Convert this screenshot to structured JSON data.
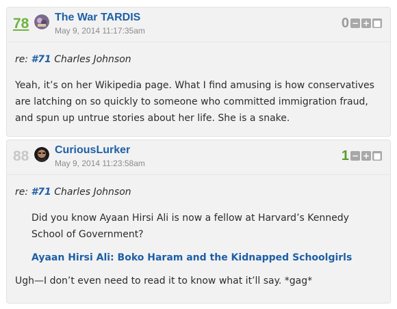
{
  "comments": [
    {
      "number": "78",
      "username": "The War TARDIS",
      "timestamp": "May 9, 2014 11:17:35am",
      "score": "0",
      "reply_prefix": "re:",
      "reply_link": "#71",
      "reply_name": "Charles Johnson",
      "body": "Yeah, it’s on her Wikipedia page. What I find amusing is how conservatives are latching on so quickly to someone who committed immigration fraud, and spun up untrue stories about her life. She is a snake."
    },
    {
      "number": "88",
      "username": "CuriousLurker",
      "timestamp": "May 9, 2014 11:23:58am",
      "score": "1",
      "reply_prefix": "re:",
      "reply_link": "#71",
      "reply_name": "Charles Johnson",
      "quote_text": "Did you know Ayaan Hirsi Ali is now a fellow at Harvard’s Kennedy School of Government?",
      "quote_link": "Ayaan Hirsi Ali: Boko Haram and the Kidnapped Schoolgirls",
      "body": "Ugh—I don’t even need to read it to know what it’ll say. *gag*"
    }
  ],
  "buttons": {
    "minus": "−",
    "plus": "+",
    "flag": "■"
  }
}
